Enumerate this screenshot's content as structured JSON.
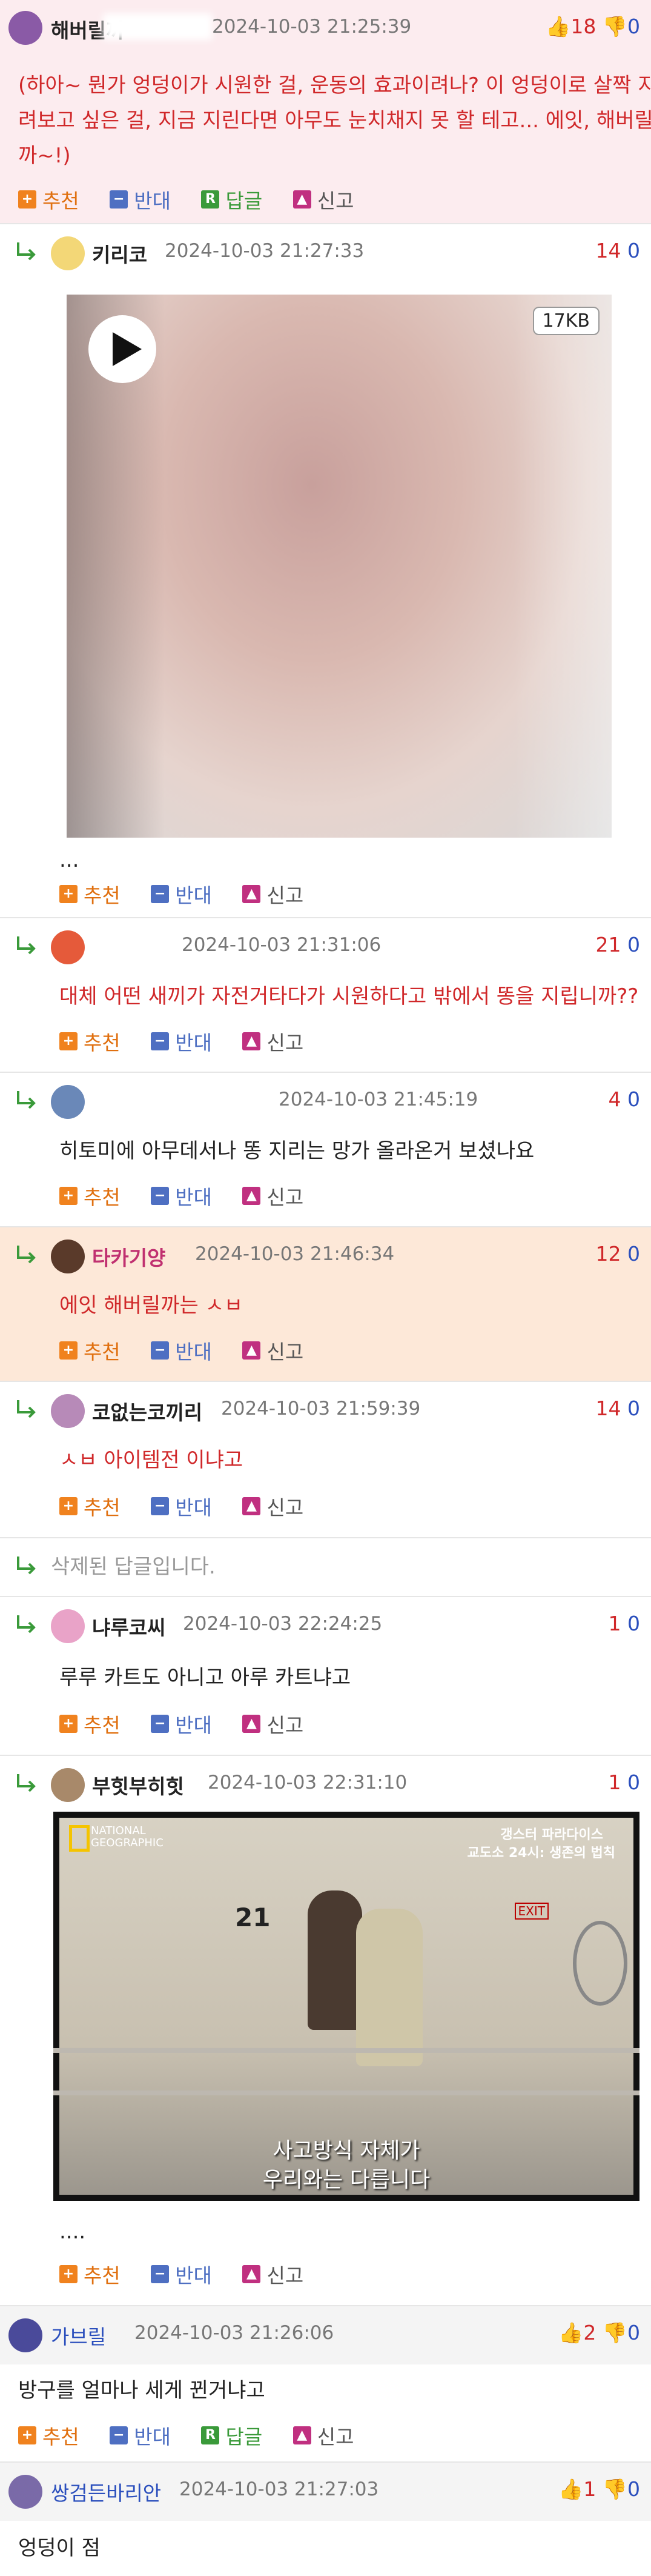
{
  "actions": {
    "recommend": "추천",
    "oppose": "반대",
    "reply": "답글",
    "report": "신고"
  },
  "comments": [
    {
      "nick": "해버릴까",
      "time": "2024-10-03 21:25:39",
      "up": "18",
      "down": "0",
      "text": [
        "(하아~ 뭔가 엉덩이가 시원한 걸, 운동의 효과이려나? 이 엉덩이로 살짝 지",
        "려보고 싶은 걸, 지금 지린다면 아무도 눈치채지 못 할 테고... 에잇, 해버릴",
        "까~!)"
      ]
    },
    {
      "nick": "키리코",
      "time": "2024-10-03 21:27:33",
      "up": "14",
      "down": "0",
      "media_badge": "17KB",
      "text": [
        "..."
      ]
    },
    {
      "nick": "",
      "time": "2024-10-03 21:31:06",
      "up": "21",
      "down": "0",
      "text": [
        "대체 어떤 새끼가 자전거타다가 시원하다고 밖에서 똥을 지립니까??"
      ]
    },
    {
      "nick": "",
      "time": "2024-10-03 21:45:19",
      "up": "4",
      "down": "0",
      "text": [
        "히토미에 아무데서나 똥 지리는 망가 올라온거 보셨나요"
      ]
    },
    {
      "nick": "타카기양",
      "time": "2024-10-03 21:46:34",
      "up": "12",
      "down": "0",
      "text": [
        "에잇 해버릴까는 ㅅㅂ"
      ]
    },
    {
      "nick": "코없는코끼리",
      "time": "2024-10-03 21:59:39",
      "up": "14",
      "down": "0",
      "text": [
        "ㅅㅂ 아이템전 이냐고"
      ]
    },
    {
      "deleted": "삭제된 답글입니다."
    },
    {
      "nick": "냐루코씨",
      "time": "2024-10-03 22:24:25",
      "up": "1",
      "down": "0",
      "text": [
        "루루 카트도 아니고 아루 카트냐고"
      ]
    },
    {
      "nick": "부힛부히힛",
      "time": "2024-10-03 22:31:10",
      "up": "1",
      "down": "0",
      "tv_logo": "NATIONAL GEOGRAPHIC",
      "tv_title_1": "갱스터 파라다이스",
      "tv_title_2": "교도소 24시: 생존의 법칙",
      "subtitle_1": "사고방식 자체가",
      "subtitle_2": "우리와는 다릅니다",
      "door_number": "21",
      "exit_sign": "EXIT",
      "text": [
        "...."
      ]
    },
    {
      "nick": "가브릴",
      "time": "2024-10-03 21:26:06",
      "up": "2",
      "down": "0",
      "text": [
        "방구를 얼마나 세게 뀐거냐고"
      ]
    },
    {
      "nick": "쌍검든바리안",
      "time": "2024-10-03 21:27:03",
      "up": "1",
      "down": "0",
      "text": [
        "엉덩이 점"
      ]
    }
  ],
  "colors": {
    "upvote": "#d0282a",
    "downvote": "#2b4fbd",
    "highlight_bg": "#fde8d8",
    "top_bg": "#fcecef"
  }
}
